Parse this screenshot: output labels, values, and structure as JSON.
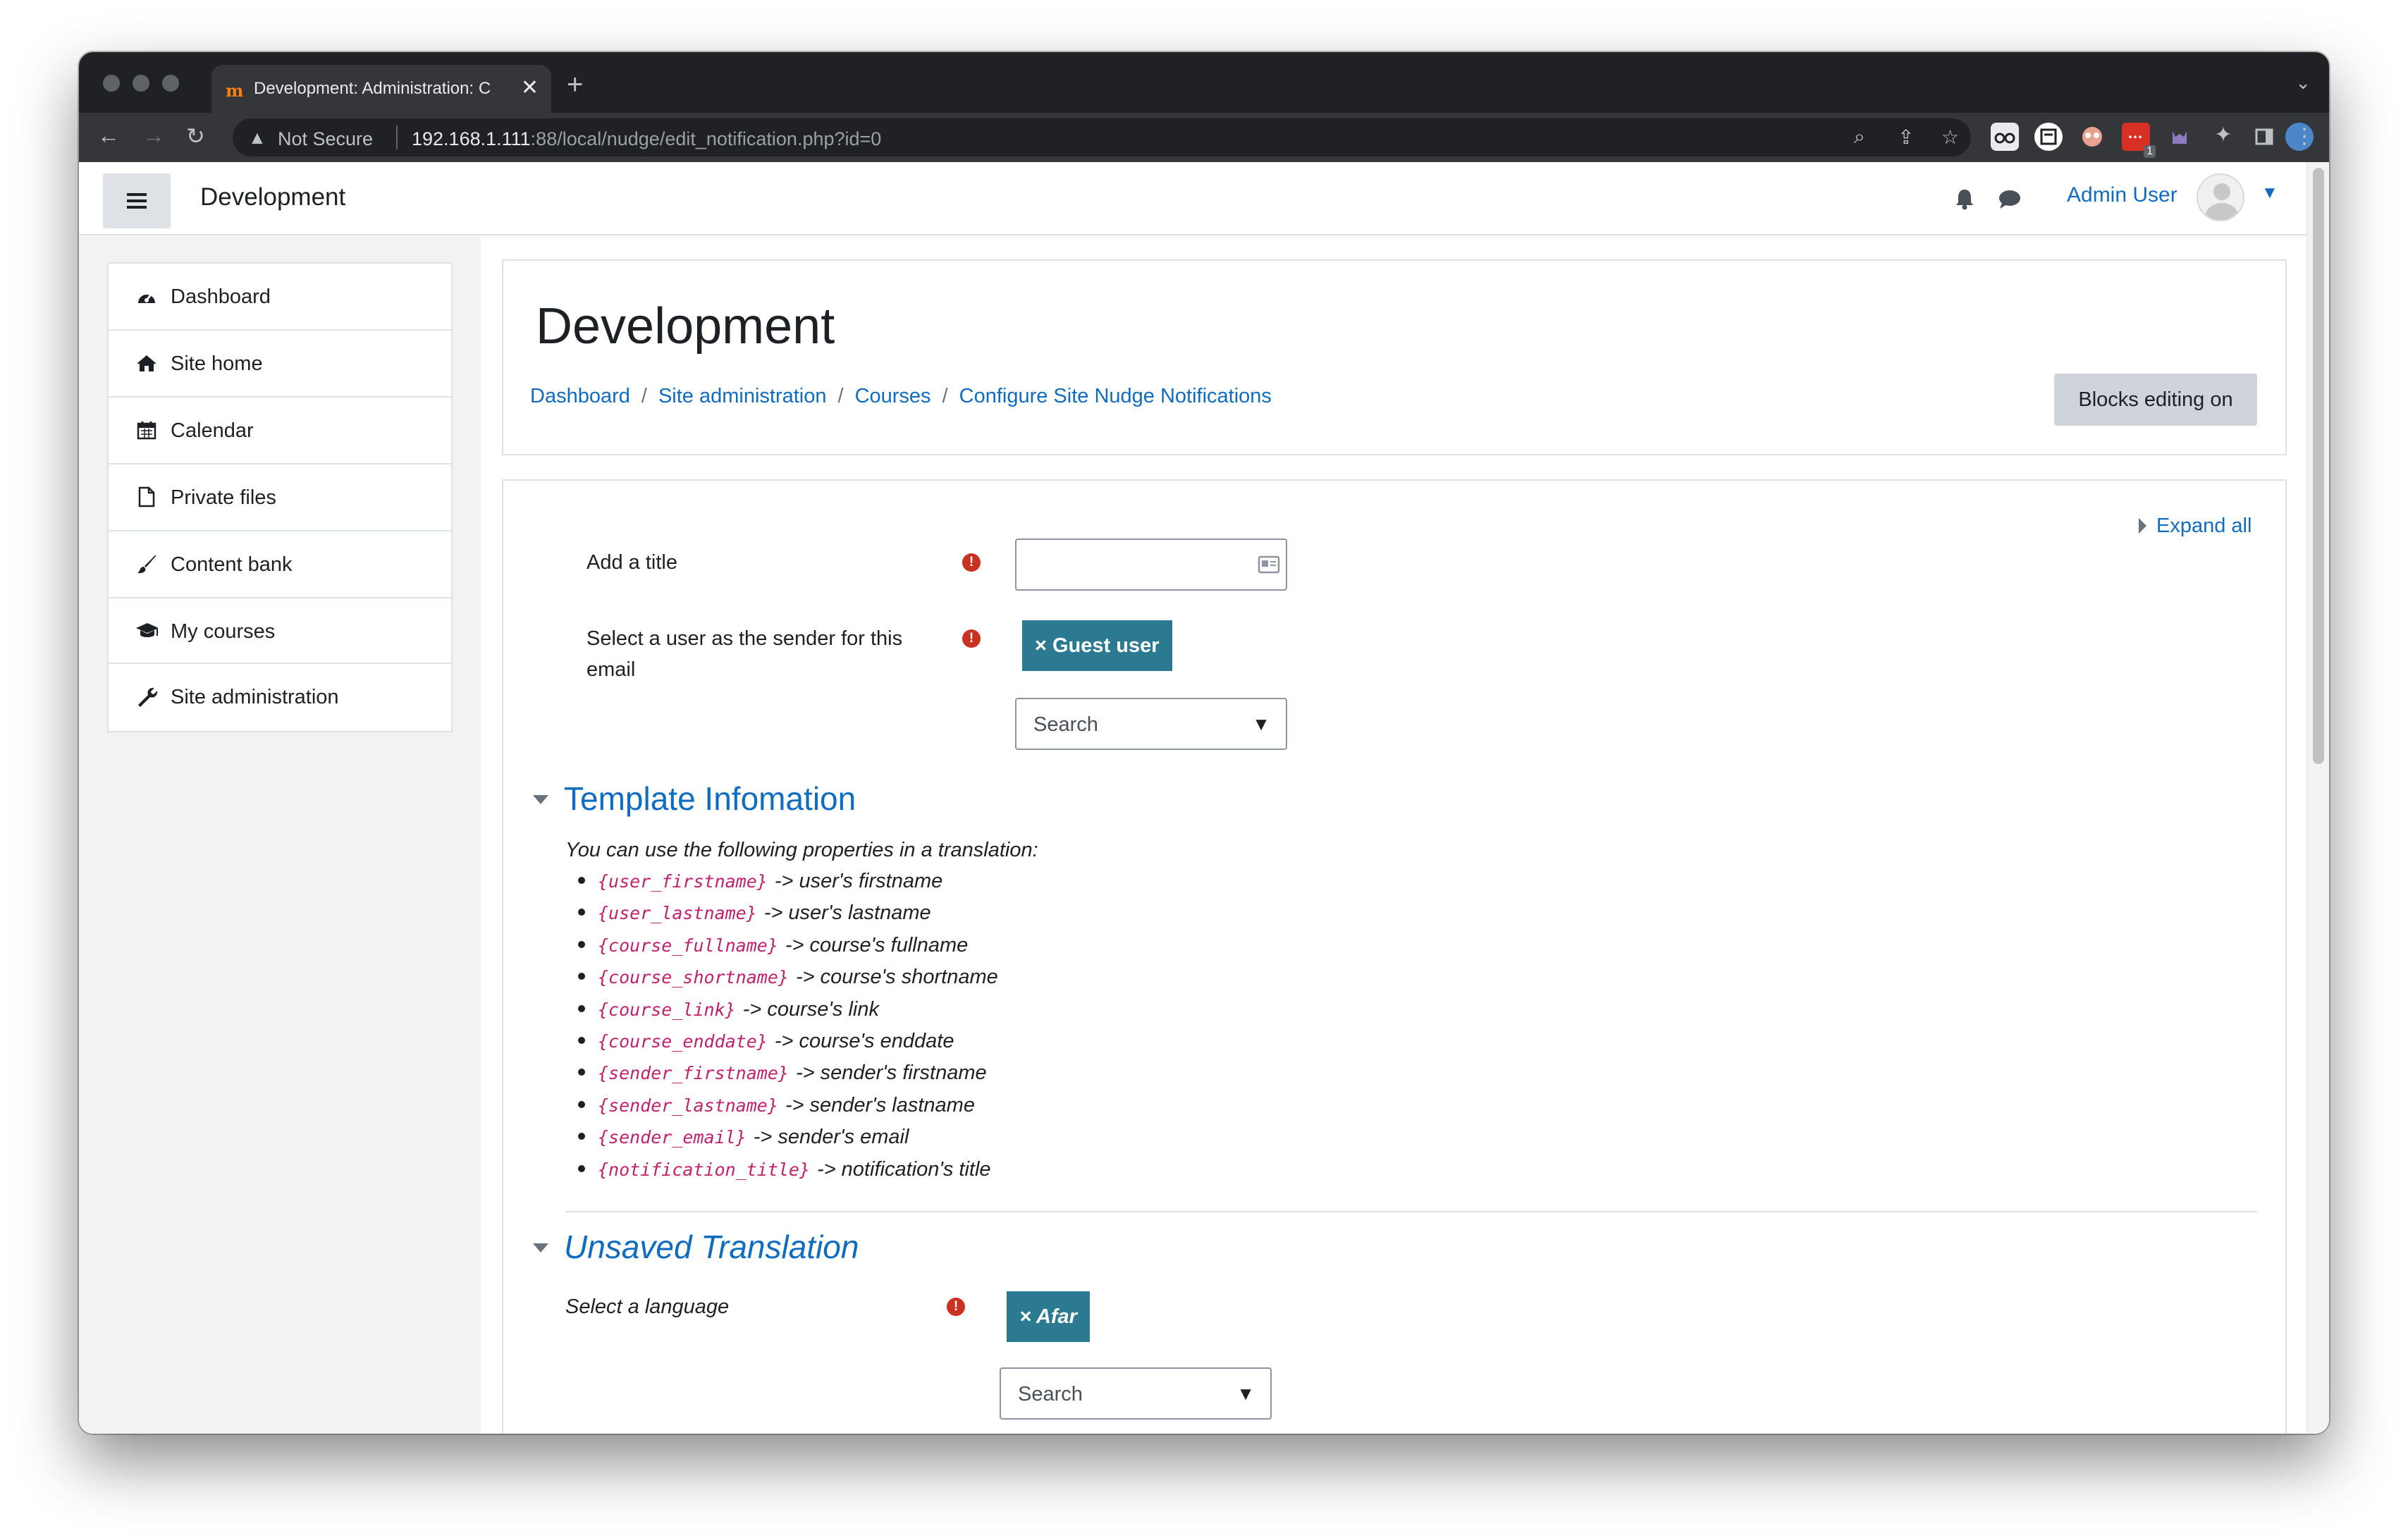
{
  "browser": {
    "tab_title": "Development: Administration: C",
    "tab_favicon": "m",
    "new_tab_icon": "+",
    "security_label": "Not Secure",
    "url_host": "192.168.1.111",
    "url_rest": ":88/local/nudge/edit_notification.php?id=0",
    "extension_badge": "1"
  },
  "navbar": {
    "site_name": "Development",
    "user_name": "Admin User"
  },
  "drawer": {
    "items": [
      {
        "label": "Dashboard",
        "icon": "dashboard-icon"
      },
      {
        "label": "Site home",
        "icon": "home-icon"
      },
      {
        "label": "Calendar",
        "icon": "calendar-icon"
      },
      {
        "label": "Private files",
        "icon": "file-icon"
      },
      {
        "label": "Content bank",
        "icon": "brush-icon"
      },
      {
        "label": "My courses",
        "icon": "graduation-cap-icon"
      }
    ],
    "admin": {
      "label": "Site administration",
      "icon": "wrench-icon"
    }
  },
  "header": {
    "title": "Development",
    "breadcrumb": [
      "Dashboard",
      "Site administration",
      "Courses",
      "Configure Site Nudge Notifications"
    ],
    "separator": "/",
    "blocks_button": "Blocks editing on"
  },
  "form": {
    "expand_all": "Expand all",
    "title_label": "Add a title",
    "title_value": "",
    "sender_label": "Select a user as the sender for this email",
    "sender_chip": "× Guest user",
    "sender_search_placeholder": "Search",
    "template_section": "Template Infomation",
    "template_intro": "You can use the following properties in a translation:",
    "properties": [
      {
        "code": "{user_firstname}",
        "desc": "-> user's firstname"
      },
      {
        "code": "{user_lastname}",
        "desc": "-> user's lastname"
      },
      {
        "code": "{course_fullname}",
        "desc": "-> course's fullname"
      },
      {
        "code": "{course_shortname}",
        "desc": "-> course's shortname"
      },
      {
        "code": "{course_link}",
        "desc": "-> course's link"
      },
      {
        "code": "{course_enddate}",
        "desc": "-> course's enddate"
      },
      {
        "code": "{sender_firstname}",
        "desc": "-> sender's firstname"
      },
      {
        "code": "{sender_lastname}",
        "desc": "-> sender's lastname"
      },
      {
        "code": "{sender_email}",
        "desc": "-> sender's email"
      },
      {
        "code": "{notification_title}",
        "desc": "-> notification's title"
      }
    ],
    "translation_section": "Unsaved Translation",
    "language_label": "Select a language",
    "language_chip": "× Afar",
    "language_search_placeholder": "Search",
    "required_mark": "!",
    "dropdown_arrow": "▼"
  },
  "colors": {
    "link": "#0f6cbf",
    "chip": "#2c7a91",
    "required": "#ca3120",
    "code": "#c0226a"
  }
}
